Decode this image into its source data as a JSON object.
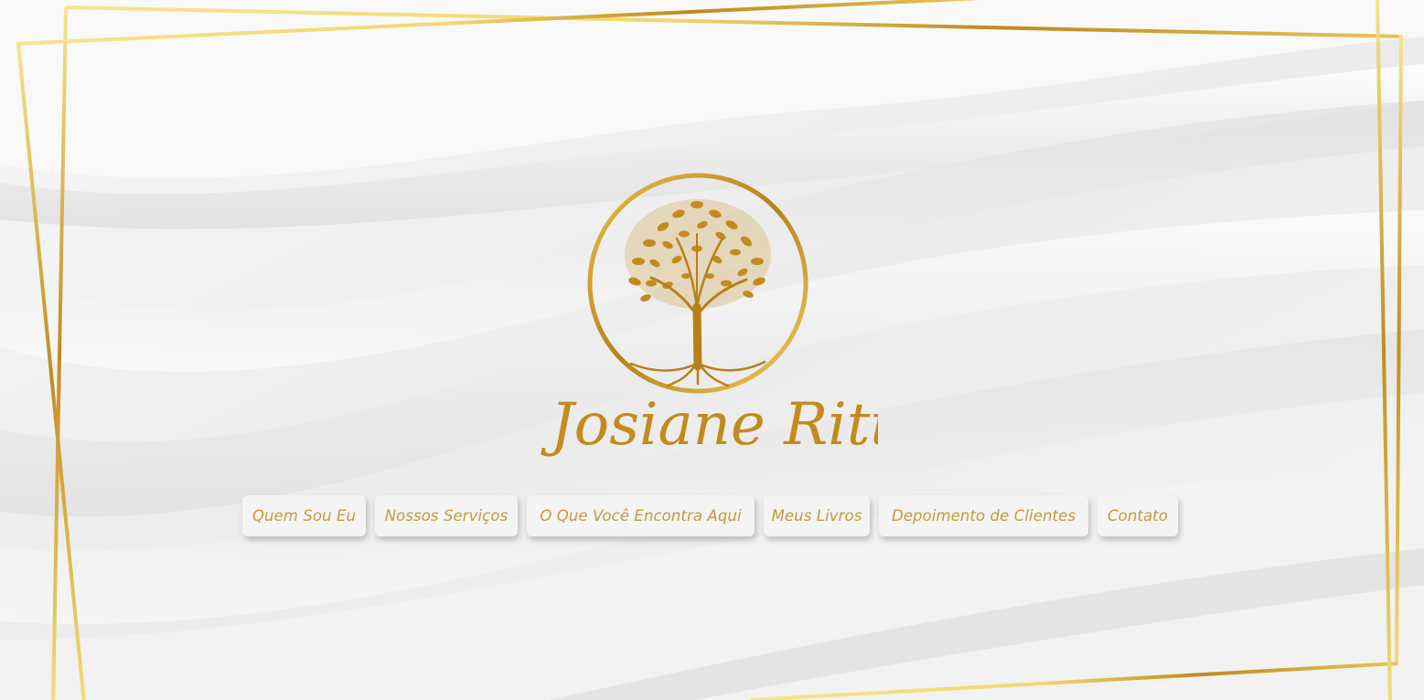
{
  "brand": {
    "name": "Josiane Ritta",
    "logo_icon": "golden-tree-of-life-icon"
  },
  "nav": {
    "items": [
      {
        "label": "Quem Sou Eu"
      },
      {
        "label": "Nossos Serviços"
      },
      {
        "label": "O Que Você Encontra Aqui"
      },
      {
        "label": "Meus Livros"
      },
      {
        "label": "Depoimento de Clientes"
      },
      {
        "label": "Contato"
      }
    ]
  },
  "colors": {
    "gold": "#c9952a",
    "gold_light": "#f7e48c",
    "nav_text": "#c59a3a",
    "background": "#efefef"
  }
}
